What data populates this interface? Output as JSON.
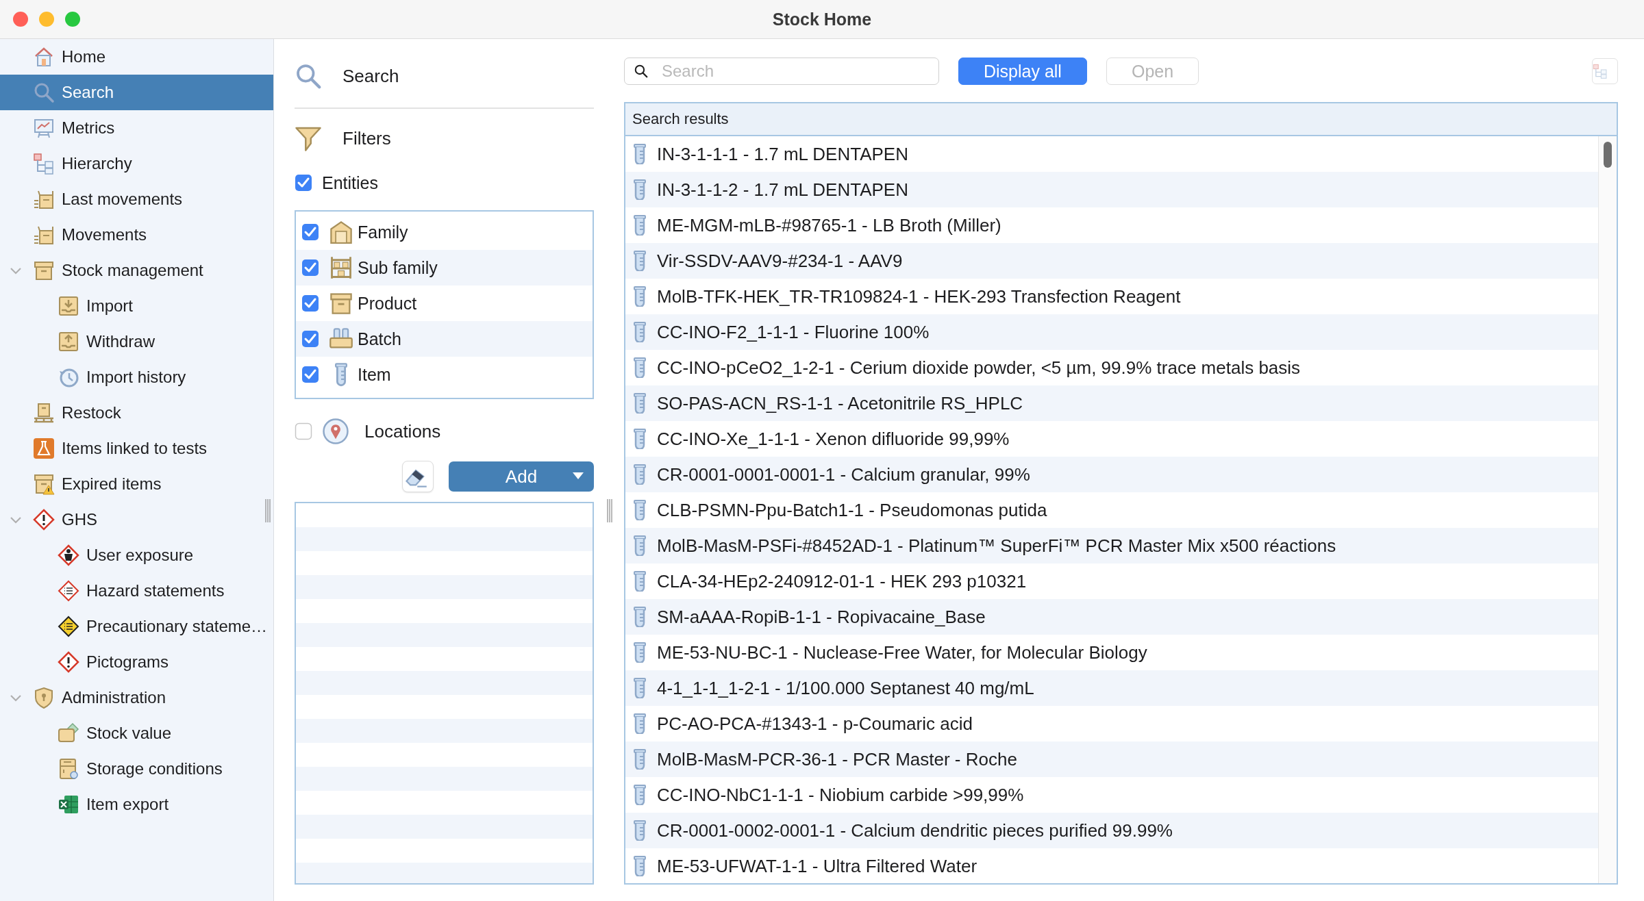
{
  "window": {
    "title": "Stock Home"
  },
  "sidebar": {
    "items": [
      {
        "label": "Home",
        "selected": false
      },
      {
        "label": "Search",
        "selected": true
      },
      {
        "label": "Metrics",
        "selected": false
      },
      {
        "label": "Hierarchy",
        "selected": false
      },
      {
        "label": "Last movements",
        "selected": false
      },
      {
        "label": "Movements",
        "selected": false
      },
      {
        "label": "Stock management",
        "selected": false,
        "expanded": true,
        "children": [
          {
            "label": "Import",
            "selected": false
          },
          {
            "label": "Withdraw",
            "selected": false
          },
          {
            "label": "Import history",
            "selected": false
          }
        ]
      },
      {
        "label": "Restock",
        "selected": false
      },
      {
        "label": "Items linked to tests",
        "selected": false
      },
      {
        "label": "Expired items",
        "selected": false
      },
      {
        "label": "GHS",
        "selected": false,
        "expanded": true,
        "children": [
          {
            "label": "User exposure",
            "selected": false
          },
          {
            "label": "Hazard statements",
            "selected": false
          },
          {
            "label": "Precautionary stateme…",
            "selected": false
          },
          {
            "label": "Pictograms",
            "selected": false
          }
        ]
      },
      {
        "label": "Administration",
        "selected": false,
        "expanded": true,
        "children": [
          {
            "label": "Stock value",
            "selected": false
          },
          {
            "label": "Storage conditions",
            "selected": false
          },
          {
            "label": "Item export",
            "selected": false
          }
        ]
      }
    ]
  },
  "filters": {
    "search_label": "Search",
    "filters_label": "Filters",
    "entities": {
      "label": "Entities",
      "checked": true,
      "items": [
        {
          "label": "Family",
          "checked": true
        },
        {
          "label": "Sub family",
          "checked": true
        },
        {
          "label": "Product",
          "checked": true
        },
        {
          "label": "Batch",
          "checked": true
        },
        {
          "label": "Item",
          "checked": true
        }
      ]
    },
    "locations": {
      "label": "Locations",
      "checked": false
    },
    "add_button": "Add"
  },
  "toolbar": {
    "search": {
      "placeholder": "Search"
    },
    "display_all": "Display all",
    "open": {
      "label": "Open",
      "disabled": true
    }
  },
  "results": {
    "title": "Search results",
    "rows": [
      "IN-3-1-1-1 - 1.7 mL DENTAPEN",
      "IN-3-1-1-2 - 1.7 mL DENTAPEN",
      "ME-MGM-mLB-#98765-1 - LB Broth (Miller)",
      "Vir-SSDV-AAV9-#234-1 - AAV9",
      "MolB-TFK-HEK_TR-TR109824-1 - HEK-293 Transfection Reagent",
      "CC-INO-F2_1-1-1 - Fluorine 100%",
      "CC-INO-pCeO2_1-2-1 - Cerium dioxide powder, <5 µm, 99.9% trace metals basis",
      "SO-PAS-ACN_RS-1-1 - Acetonitrile RS_HPLC",
      "CC-INO-Xe_1-1-1 - Xenon difluoride 99,99%",
      "CR-0001-0001-0001-1 - Calcium granular, 99%",
      "CLB-PSMN-Ppu-Batch1-1 - Pseudomonas putida",
      "MolB-MasM-PSFi-#8452AD-1 - Platinum™ SuperFi™ PCR Master Mix x500 réactions",
      "CLA-34-HEp2-240912-01-1 - HEK 293 p10321",
      "SM-aAAA-RopiB-1-1 - Ropivacaine_Base",
      "ME-53-NU-BC-1 - Nuclease-Free Water, for Molecular Biology",
      "4-1_1-1_1-2-1 - 1/100.000 Septanest 40 mg/mL",
      "PC-AO-PCA-#1343-1 - p-Coumaric acid",
      "MolB-MasM-PCR-36-1 - PCR Master - Roche",
      "CC-INO-NbC1-1-1 - Niobium carbide >99,99%",
      "CR-0001-0002-0001-1 - Calcium dendritic pieces purified 99.99%",
      "ME-53-UFWAT-1-1 - Ultra Filtered Water"
    ]
  }
}
